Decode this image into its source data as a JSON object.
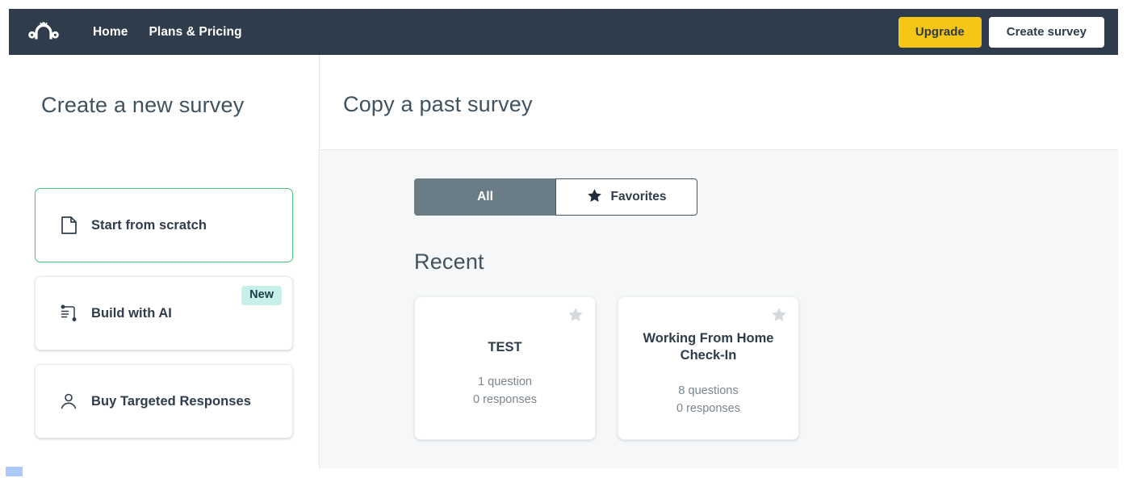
{
  "header": {
    "logo_name": "surveymonkey-logo",
    "nav_links": [
      {
        "label": "Home"
      },
      {
        "label": "Plans & Pricing"
      }
    ],
    "upgrade_label": "Upgrade",
    "create_survey_label": "Create survey",
    "bg_color": "#2f3c4b",
    "upgrade_color": "#f5c518"
  },
  "left": {
    "title": "Create a new survey",
    "options": [
      {
        "label": "Start from scratch",
        "icon": "page-document-icon",
        "selected": true,
        "badge": ""
      },
      {
        "label": "Build with AI",
        "icon": "ai-list-icon",
        "selected": false,
        "badge": "New"
      },
      {
        "label": "Buy Targeted Responses",
        "icon": "person-icon",
        "selected": false,
        "badge": ""
      }
    ],
    "selected_border_color": "#4fc47f",
    "badge_bg_color": "#c7f0ea"
  },
  "right": {
    "title": "Copy a past survey",
    "filters": [
      {
        "label": "All",
        "active": true,
        "icon": ""
      },
      {
        "label": "Favorites",
        "active": false,
        "icon": "star-icon"
      }
    ],
    "section_title": "Recent",
    "active_filter_color": "#6a7c85",
    "surveys": [
      {
        "title": "TEST",
        "questions": "1 question",
        "responses": "0 responses",
        "favorite": false
      },
      {
        "title": "Working From Home Check-In",
        "questions": "8 questions",
        "responses": "0 responses",
        "favorite": false
      }
    ]
  }
}
